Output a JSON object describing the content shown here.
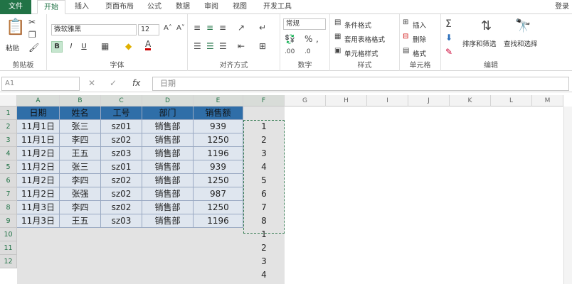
{
  "tabs": [
    "文件",
    "开始",
    "插入",
    "页面布局",
    "公式",
    "数据",
    "审阅",
    "视图",
    "开发工具"
  ],
  "login": "登录",
  "ribbon": {
    "clipboard": {
      "paste": "粘贴",
      "label": "剪贴板"
    },
    "font": {
      "name": "微软雅黑",
      "size": "12",
      "bold": "B",
      "italic": "I",
      "underline": "U",
      "label": "字体"
    },
    "align": {
      "label": "对齐方式"
    },
    "number": {
      "format": "常规",
      "label": "数字"
    },
    "styles": {
      "cond": "条件格式",
      "table": "套用表格格式",
      "cell": "单元格样式",
      "label": "样式"
    },
    "cells": {
      "insert": "插入",
      "delete": "删除",
      "format": "格式",
      "label": "单元格"
    },
    "editing": {
      "sort": "排序和筛选",
      "find": "查找和选择",
      "label": "编辑"
    }
  },
  "formula_bar": {
    "name_box": "A1",
    "value": "日期"
  },
  "columns": [
    "A",
    "B",
    "C",
    "D",
    "E",
    "F",
    "G",
    "H",
    "I",
    "J",
    "K",
    "L",
    "M"
  ],
  "rows": [
    "1",
    "2",
    "3",
    "4",
    "5",
    "6",
    "7",
    "8",
    "9",
    "10",
    "11",
    "12"
  ],
  "table": {
    "headers": [
      "日期",
      "姓名",
      "工号",
      "部门",
      "销售额"
    ],
    "rows": [
      [
        "11月1日",
        "张三",
        "sz01",
        "销售部",
        "939"
      ],
      [
        "11月1日",
        "李四",
        "sz02",
        "销售部",
        "1250"
      ],
      [
        "11月2日",
        "王五",
        "sz03",
        "销售部",
        "1196"
      ],
      [
        "11月2日",
        "张三",
        "sz01",
        "销售部",
        "939"
      ],
      [
        "11月2日",
        "李四",
        "sz02",
        "销售部",
        "1250"
      ],
      [
        "11月2日",
        "张强",
        "sz02",
        "销售部",
        "987"
      ],
      [
        "11月3日",
        "李四",
        "sz02",
        "销售部",
        "1250"
      ],
      [
        "11月3日",
        "王五",
        "sz03",
        "销售部",
        "1196"
      ]
    ]
  },
  "column_f": [
    "1",
    "2",
    "3",
    "4",
    "5",
    "6",
    "7",
    "8",
    "1",
    "2",
    "3",
    "4"
  ]
}
